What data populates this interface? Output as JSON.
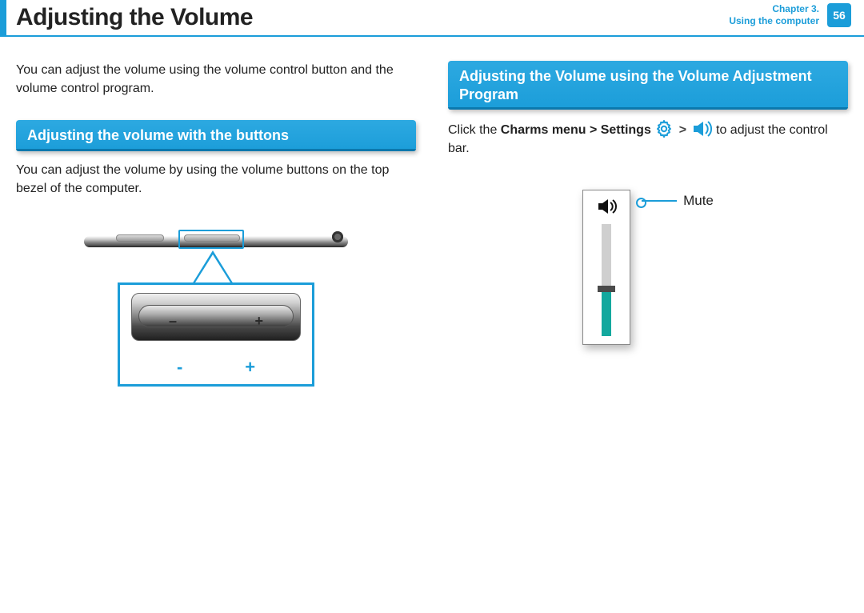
{
  "header": {
    "title": "Adjusting the Volume",
    "chapter_line1": "Chapter 3.",
    "chapter_line2": "Using the computer",
    "page_number": "56"
  },
  "left": {
    "intro": "You can adjust the volume using the volume control button and the volume control program.",
    "section_title": "Adjusting the volume with the buttons",
    "section_body": "You can adjust the volume by using the volume buttons on the top bezel of the computer.",
    "zoom": {
      "minus": "-",
      "plus": "+"
    }
  },
  "right": {
    "section_title": "Adjusting the Volume using the Volume Adjustment Program",
    "line_pre": "Click the ",
    "charms_bold": "Charms menu > Settings",
    "gt": ">",
    "line_post": " to adjust the control bar.",
    "mute_label": "Mute"
  }
}
